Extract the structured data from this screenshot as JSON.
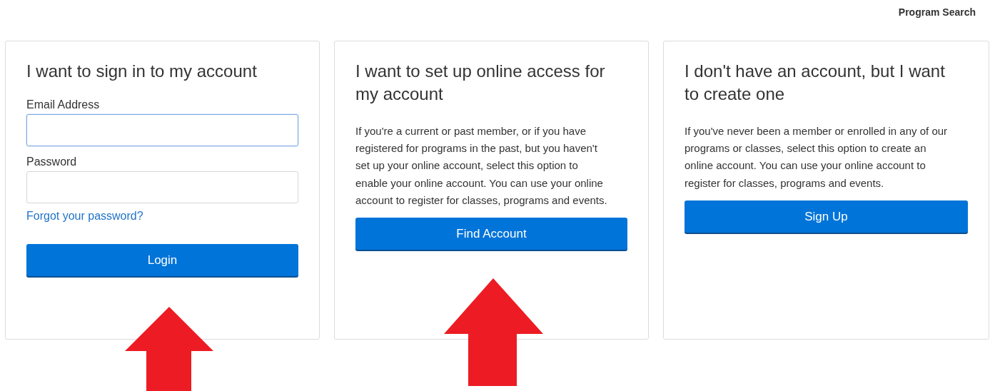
{
  "header": {
    "link": "Program Search"
  },
  "cards": [
    {
      "kind": "login",
      "title": "I want to sign in to my account",
      "fields": [
        {
          "label": "Email Address",
          "focused": true
        },
        {
          "label": "Password",
          "focused": false
        }
      ],
      "link": "Forgot your password?",
      "button": "Login"
    },
    {
      "kind": "info",
      "title": "I want to set up online access for my account",
      "text": "If you're a current or past member, or if you have registered for programs in the past, but you haven't set up your online account, select this option to enable your online account. You can use your online account to register for classes, programs and events.",
      "button": "Find Account"
    },
    {
      "kind": "info",
      "title": "I don't have an account, but I want to create one",
      "text": "If you've never been a member or enrolled in any of our programs or classes, select this option to create an online account. You can use your online account to register for classes, programs and events.",
      "button": "Sign Up"
    }
  ]
}
